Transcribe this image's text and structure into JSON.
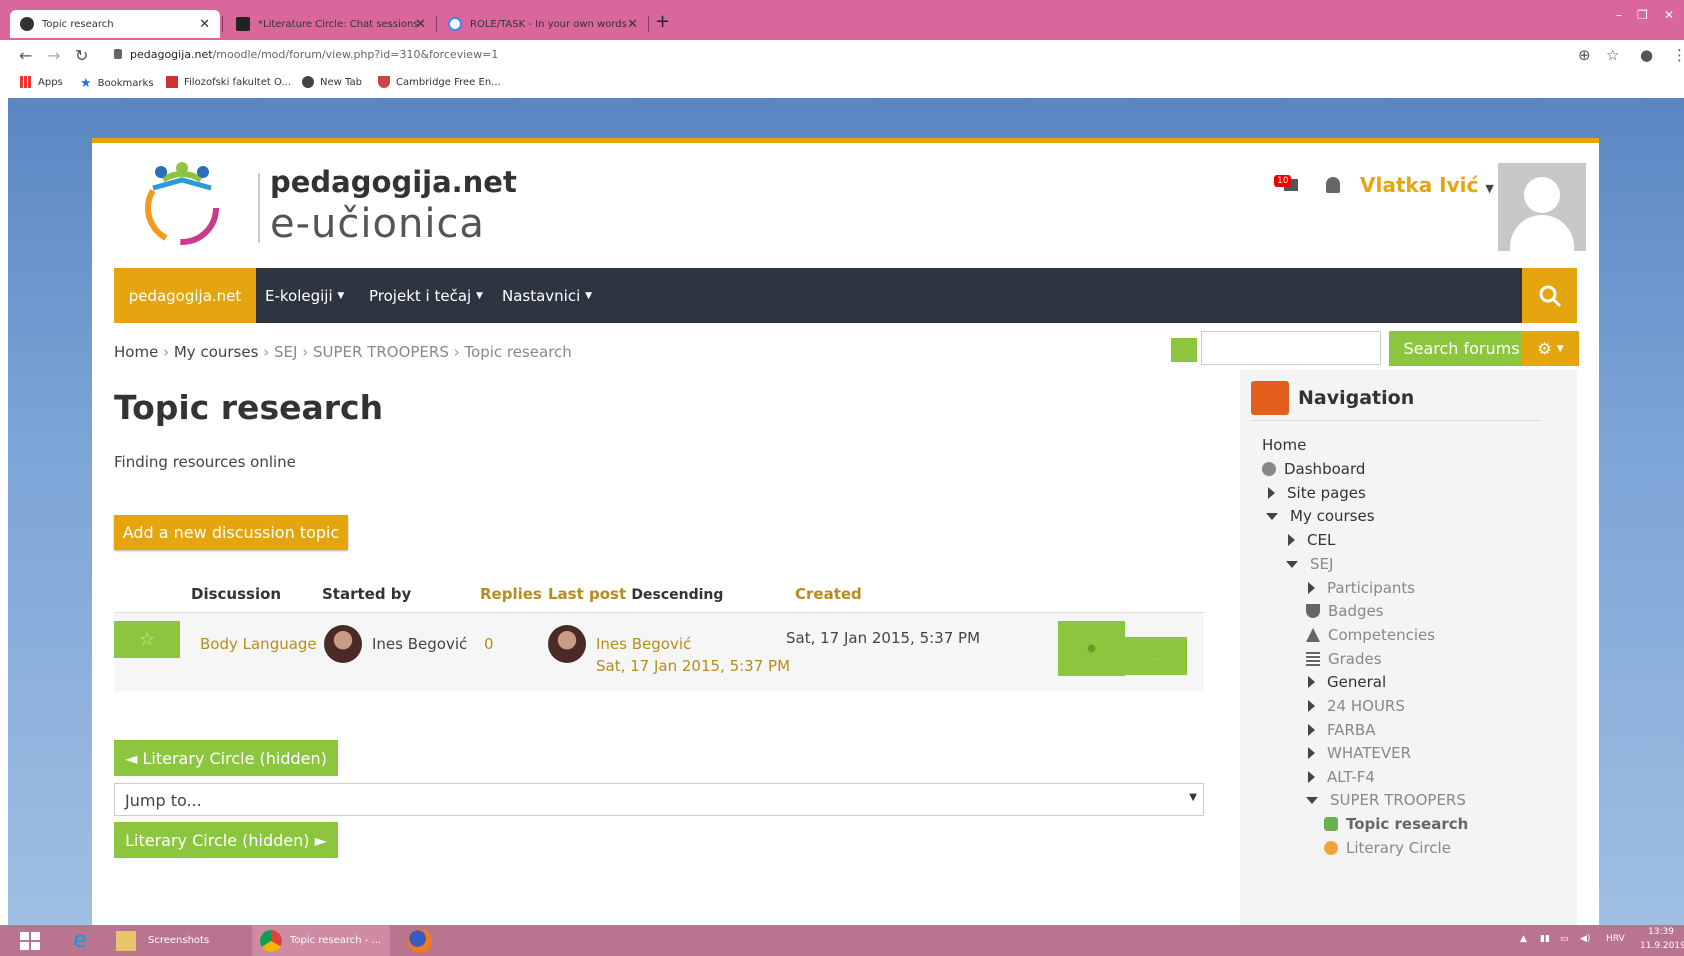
{
  "browser": {
    "tabs": [
      {
        "title": "Topic research"
      },
      {
        "title": "*Literature Circle: Chat sessions"
      },
      {
        "title": "ROLE/TASK - In your own words"
      }
    ],
    "url_host": "pedagogija.net",
    "url_path": "/moodle/mod/forum/view.php?id=310&forceview=1",
    "bookmarks": [
      "Apps",
      "Bookmarks",
      "Filozofski fakultet O...",
      "New Tab",
      "Cambridge Free En..."
    ]
  },
  "site": {
    "brand_top": "pedagogija.net",
    "brand_bottom": "e-učionica",
    "notification_count": "10",
    "user_name": "Vlatka Ivić",
    "nav": [
      "pedagogija.net",
      "E-kolegiji",
      "Projekt i tečaj",
      "Nastavnici"
    ]
  },
  "breadcrumb": [
    "Home",
    "My courses",
    "SEJ",
    "SUPER TROOPERS",
    "Topic research"
  ],
  "search": {
    "button": "Search forums"
  },
  "forum": {
    "title": "Topic research",
    "description": "Finding resources online",
    "add_button": "Add a new discussion topic",
    "columns": {
      "discussion": "Discussion",
      "started_by": "Started by",
      "replies": "Replies",
      "last_post": "Last post",
      "sort_alt": "Descending",
      "created": "Created"
    },
    "rows": [
      {
        "discussion": "Body Language",
        "started_by": "Ines Begović",
        "replies": "0",
        "last_post_user": "Ines Begović",
        "last_post_date": "Sat, 17 Jan 2015, 5:37 PM",
        "created": "Sat, 17 Jan 2015, 5:37 PM"
      }
    ],
    "prev_button": "◄ Literary Circle (hidden)",
    "jump_to": "Jump to...",
    "next_button": "Literary Circle (hidden) ►"
  },
  "navigation": {
    "title": "Navigation",
    "items": [
      "Home",
      "Dashboard",
      "Site pages",
      "My courses",
      "CEL",
      "SEJ",
      "Participants",
      "Badges",
      "Competencies",
      "Grades",
      "General",
      "24 HOURS",
      "FARBA",
      "WHATEVER",
      "ALT-F4",
      "SUPER TROOPERS",
      "Topic research",
      "Literary Circle"
    ]
  },
  "taskbar": {
    "items": [
      "Screenshots",
      "Topic research - ..."
    ],
    "lang": "HRV",
    "time": "13:39",
    "date": "11.9.2019"
  },
  "colors": {
    "accent": "#e5a50f",
    "green": "#8cc63f",
    "navbar": "#2d3540"
  }
}
